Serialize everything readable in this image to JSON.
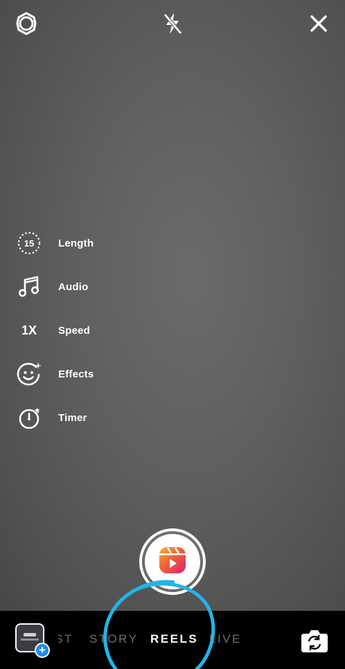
{
  "top_bar": {
    "settings_icon": "gear-icon",
    "flash_icon": "flash-off-icon",
    "close_icon": "close-icon"
  },
  "tools": [
    {
      "icon": "length-timer-icon",
      "icon_text": "15",
      "label": "Length"
    },
    {
      "icon": "music-note-icon",
      "label": "Audio"
    },
    {
      "icon": "speed-icon",
      "icon_text": "1X",
      "label": "Speed"
    },
    {
      "icon": "sparkle-face-icon",
      "label": "Effects"
    },
    {
      "icon": "stopwatch-icon",
      "label": "Timer"
    }
  ],
  "capture": {
    "icon": "reels-icon"
  },
  "bottom_bar": {
    "modes": [
      {
        "label": "POST",
        "visible_text": "ST",
        "active": false
      },
      {
        "label": "STORY",
        "active": false
      },
      {
        "label": "REELS",
        "active": true
      },
      {
        "label": "LIVE",
        "active": false
      }
    ],
    "gallery_badge": "+",
    "flip_icon": "flip-camera-icon"
  },
  "colors": {
    "annotation_circle": "#1fb6ea",
    "badge_blue": "#1a8cf0",
    "reels_gradient_start": "#f9b233",
    "reels_gradient_end": "#d1247e"
  }
}
